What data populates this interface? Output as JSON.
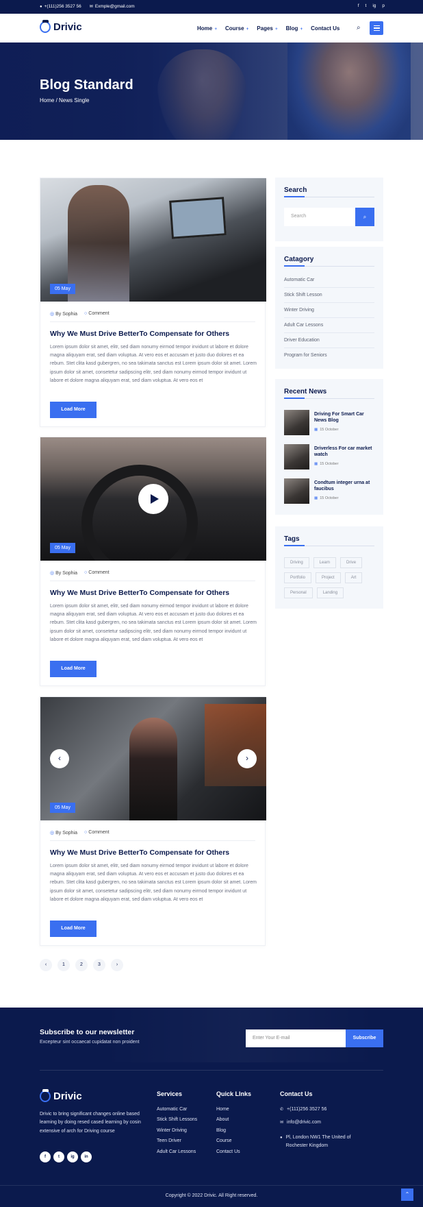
{
  "topbar": {
    "phone": "+(111)256 3527 56",
    "email": "Exmple@gmail.com",
    "social": [
      "f",
      "t",
      "ig",
      "p"
    ]
  },
  "header": {
    "brand": "Drivic",
    "nav": [
      {
        "label": "Home"
      },
      {
        "label": "Course"
      },
      {
        "label": "Pages"
      },
      {
        "label": "Blog"
      },
      {
        "label": "Contact Us"
      }
    ],
    "nav_caret": "+",
    "search_icon": "⌕",
    "menu_icon": "hamburger-icon"
  },
  "hero": {
    "title": "Blog Standard",
    "breadcrumb": "Home / News Single"
  },
  "posts": [
    {
      "date": "05 May",
      "author": "By Sophia",
      "comment": "Comment",
      "title": "Why We Must Drive BetterTo Compensate for Others",
      "excerpt": "Lorem ipsum dolor sit amet, elitr, sed diam nonumy eirmod tempor invidunt ut labore et dolore magna aliquyam erat, sed diam voluptua. At vero eos et accusam et justo duo dolores et ea rebum. Stet clita kasd gubergren, no sea takimata sanctus est Lorem ipsum dolor sit amet. Lorem ipsum dolor sit amet, consetetur sadipscing elitr, sed diam nonumy eirmod tempor invidunt ut labore et dolore magna aliquyam erat, sed diam voluptua. At vero eos et",
      "button": "Load More"
    },
    {
      "date": "05 May",
      "author": "By Sophia",
      "comment": "Comment",
      "title": "Why We Must Drive BetterTo Compensate for Others",
      "excerpt": "Lorem ipsum dolor sit amet, elitr, sed diam nonumy eirmod tempor invidunt ut labore et dolore magna aliquyam erat, sed diam voluptua. At vero eos et accusam et justo duo dolores et ea rebum. Stet clita kasd gubergren, no sea takimata sanctus est Lorem ipsum dolor sit amet. Lorem ipsum dolor sit amet, consetetur sadipscing elitr, sed diam nonumy eirmod tempor invidunt ut labore et dolore magna aliquyam erat, sed diam voluptua. At vero eos et",
      "button": "Load More"
    },
    {
      "date": "05 May",
      "author": "By Sophia",
      "comment": "Comment",
      "title": "Why We Must Drive BetterTo Compensate for Others",
      "excerpt": "Lorem ipsum dolor sit amet, elitr, sed diam nonumy eirmod tempor invidunt ut labore et dolore magna aliquyam erat, sed diam voluptua. At vero eos et accusam et justo duo dolores et ea rebum. Stet clita kasd gubergren, no sea takimata sanctus est Lorem ipsum dolor sit amet. Lorem ipsum dolor sit amet, consetetur sadipscing elitr, sed diam nonumy eirmod tempor invidunt ut labore et dolore magna aliquyam erat, sed diam voluptua. At vero eos et",
      "button": "Load More"
    }
  ],
  "pagination": {
    "prev": "‹",
    "pages": [
      "1",
      "2",
      "3"
    ],
    "next": "›"
  },
  "sidebar": {
    "search": {
      "title": "Search",
      "placeholder": "Search"
    },
    "category": {
      "title": "Catagory",
      "items": [
        "Automatic Car",
        "Stick Shift Lesson",
        "Winter Driving",
        "Adult Car Lessons",
        "Driver Education",
        "Program for Seniors"
      ]
    },
    "recent": {
      "title": "Recent News",
      "items": [
        {
          "title": "Driving For Smart Car News Blog",
          "date": "15 October"
        },
        {
          "title": "Driverless For car market watch",
          "date": "15 October"
        },
        {
          "title": "Condtum integer urna at faucibus",
          "date": "15 October"
        }
      ]
    },
    "tags": {
      "title": "Tags",
      "items": [
        "Driving",
        "Learn",
        "Drive",
        "Portfolio",
        "Project",
        "Art",
        "Personal",
        "Landing"
      ]
    }
  },
  "footer": {
    "newsletter_title": "Subscribe to our newsletter",
    "newsletter_sub": "Excepteur sint occaecat cupidatat non proident",
    "newsletter_placeholder": "Enter Your E-mail",
    "subscribe": "Subscribe",
    "brand": "Drivic",
    "about": "Drivic to bring significant changes online based learning by doing resed cased learning by cosin extensive of arch for Driving course",
    "social": [
      "f",
      "t",
      "ig",
      "in"
    ],
    "services_title": "Services",
    "services": [
      "Automatic Car",
      "Stick Shift Lessons",
      "Winter Driving",
      "Teen Driver",
      "Adult Car Lessons"
    ],
    "links_title": "Quick LInks",
    "links": [
      "Home",
      "About",
      "Blog",
      "Course",
      "Contact Us"
    ],
    "contact_title": "Contact Us",
    "contact_phone": "+(111)256 3527 56",
    "contact_email": "info@drivic.com",
    "contact_address": "Pl, London NW1 The United of Rochester Kingdom",
    "copyright": "Copyright © 2022 Drivic. All Right reserved.",
    "to_top": "⌃"
  },
  "colors": {
    "primary": "#3a6ff0",
    "navy": "#0b1a4d"
  }
}
